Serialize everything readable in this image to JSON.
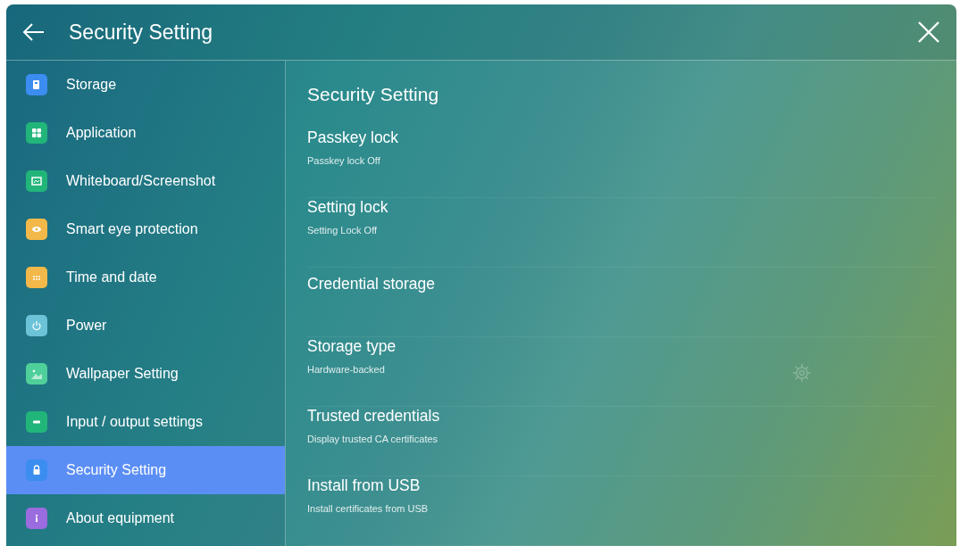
{
  "header": {
    "title": "Security Setting"
  },
  "sidebar": {
    "items": [
      {
        "label": "Storage",
        "kind": "storage",
        "color": "#3b8df0",
        "selected": false
      },
      {
        "label": "Application",
        "kind": "apps",
        "color": "#22b57a",
        "selected": false
      },
      {
        "label": "Whiteboard/Screenshot",
        "kind": "whiteboard",
        "color": "#22b57a",
        "selected": false
      },
      {
        "label": "Smart eye protection",
        "kind": "eye",
        "color": "#f2b84a",
        "selected": false
      },
      {
        "label": "Time and date",
        "kind": "calendar",
        "color": "#f2b84a",
        "selected": false
      },
      {
        "label": "Power",
        "kind": "power",
        "color": "#6cc3d8",
        "selected": false
      },
      {
        "label": "Wallpaper Setting",
        "kind": "picture",
        "color": "#4fcf9a",
        "selected": false
      },
      {
        "label": "Input / output settings",
        "kind": "port",
        "color": "#22b57a",
        "selected": false
      },
      {
        "label": "Security Setting",
        "kind": "lock",
        "color": "#3b8df0",
        "selected": true
      },
      {
        "label": "About equipment",
        "kind": "info",
        "color": "#9b6be0",
        "selected": false
      }
    ]
  },
  "content": {
    "title": "Security Setting",
    "items": [
      {
        "title": "Passkey lock",
        "subtitle": "Passkey lock Off"
      },
      {
        "title": "Setting lock",
        "subtitle": "Setting Lock Off"
      },
      {
        "title": "Credential storage"
      },
      {
        "title": "Storage type",
        "subtitle": "Hardware-backed"
      },
      {
        "title": "Trusted credentials",
        "subtitle": "Display trusted CA certificates"
      },
      {
        "title": "Install from USB",
        "subtitle": "Install certificates from USB"
      }
    ]
  }
}
